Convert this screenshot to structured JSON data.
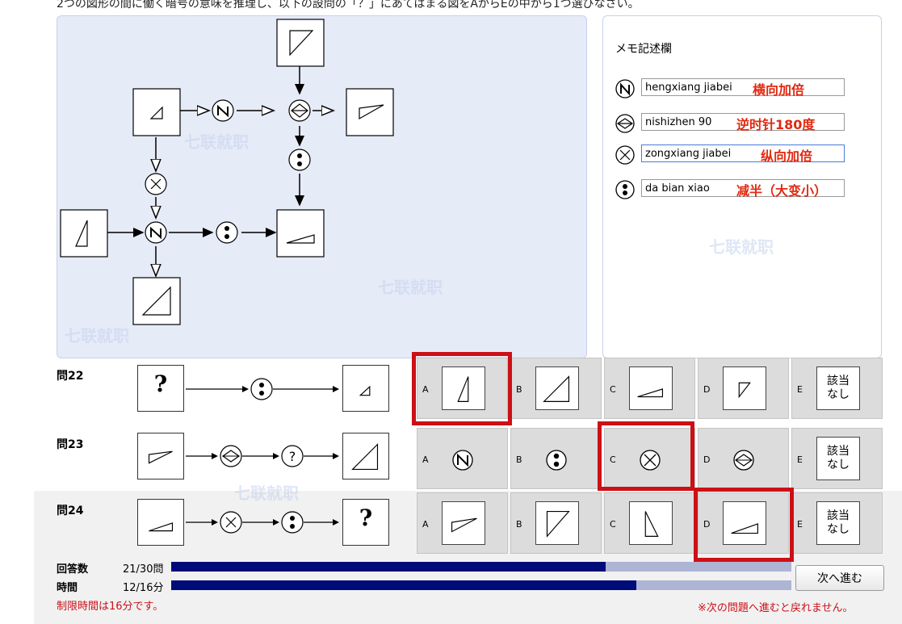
{
  "instruction": "2つの図形の間に働く暗号の意味を推理し、以下の設問の「？」にあてはまる図をAからEの中から1つ選びなさい。",
  "memo": {
    "title": "メモ記述欄",
    "rows": [
      {
        "icon": "yokomuki-icon",
        "value": "hengxiang jiabei",
        "annotation": "横向加倍"
      },
      {
        "icon": "rotate-diamond-icon",
        "value": "nishizhen 90",
        "annotation": "逆时针180度"
      },
      {
        "icon": "swirl-icon",
        "value": "zongxiang jiabei",
        "annotation": "纵向加倍"
      },
      {
        "icon": "colon-icon",
        "value": "da bian xiao",
        "annotation": "减半（大变小）"
      }
    ]
  },
  "questions": [
    {
      "label": "問22",
      "left": "?",
      "ops": [
        "colon"
      ],
      "right": "small-triangle",
      "options": [
        {
          "letter": "A",
          "kind": "tall-triangle"
        },
        {
          "letter": "B",
          "kind": "big-triangle"
        },
        {
          "letter": "C",
          "kind": "wide-triangle"
        },
        {
          "letter": "D",
          "kind": "flag-triangle"
        },
        {
          "letter": "E",
          "kind": "none",
          "text_line1": "該当",
          "text_line2": "なし"
        }
      ],
      "selected": "A"
    },
    {
      "label": "問23",
      "left": "flag-wide",
      "ops": [
        "diamond",
        "?"
      ],
      "right": "big-triangle",
      "options": [
        {
          "letter": "A",
          "kind": "op-yokomuki"
        },
        {
          "letter": "B",
          "kind": "op-colon"
        },
        {
          "letter": "C",
          "kind": "op-swirl"
        },
        {
          "letter": "D",
          "kind": "op-diamond"
        },
        {
          "letter": "E",
          "kind": "none",
          "text_line1": "該当",
          "text_line2": "なし"
        }
      ],
      "selected": "C"
    },
    {
      "label": "問24",
      "left": "wide-triangle",
      "ops": [
        "swirl",
        "colon"
      ],
      "right": "?",
      "options": [
        {
          "letter": "A",
          "kind": "flag-wide"
        },
        {
          "letter": "B",
          "kind": "flag-tall"
        },
        {
          "letter": "C",
          "kind": "tall-right-triangle"
        },
        {
          "letter": "D",
          "kind": "wide-triangle"
        },
        {
          "letter": "E",
          "kind": "none",
          "text_line1": "該当",
          "text_line2": "なし"
        }
      ],
      "selected": "D"
    }
  ],
  "question_mark": "?",
  "status": {
    "answers_label": "回答数",
    "answers_value": "21/30問",
    "answers_progress": 0.7,
    "time_label": "時間",
    "time_value": "12/16分",
    "time_progress": 0.75,
    "limit_note": "制限時間は16分です。",
    "warning_note": "※次の問題へ進むと戻れません。",
    "next_button": "次へ進む"
  },
  "watermark_text": "七联就职",
  "colors": {
    "accent_red": "#cc1016",
    "progress_fill": "#000b7a",
    "panel_bg": "#e6ebf8"
  }
}
